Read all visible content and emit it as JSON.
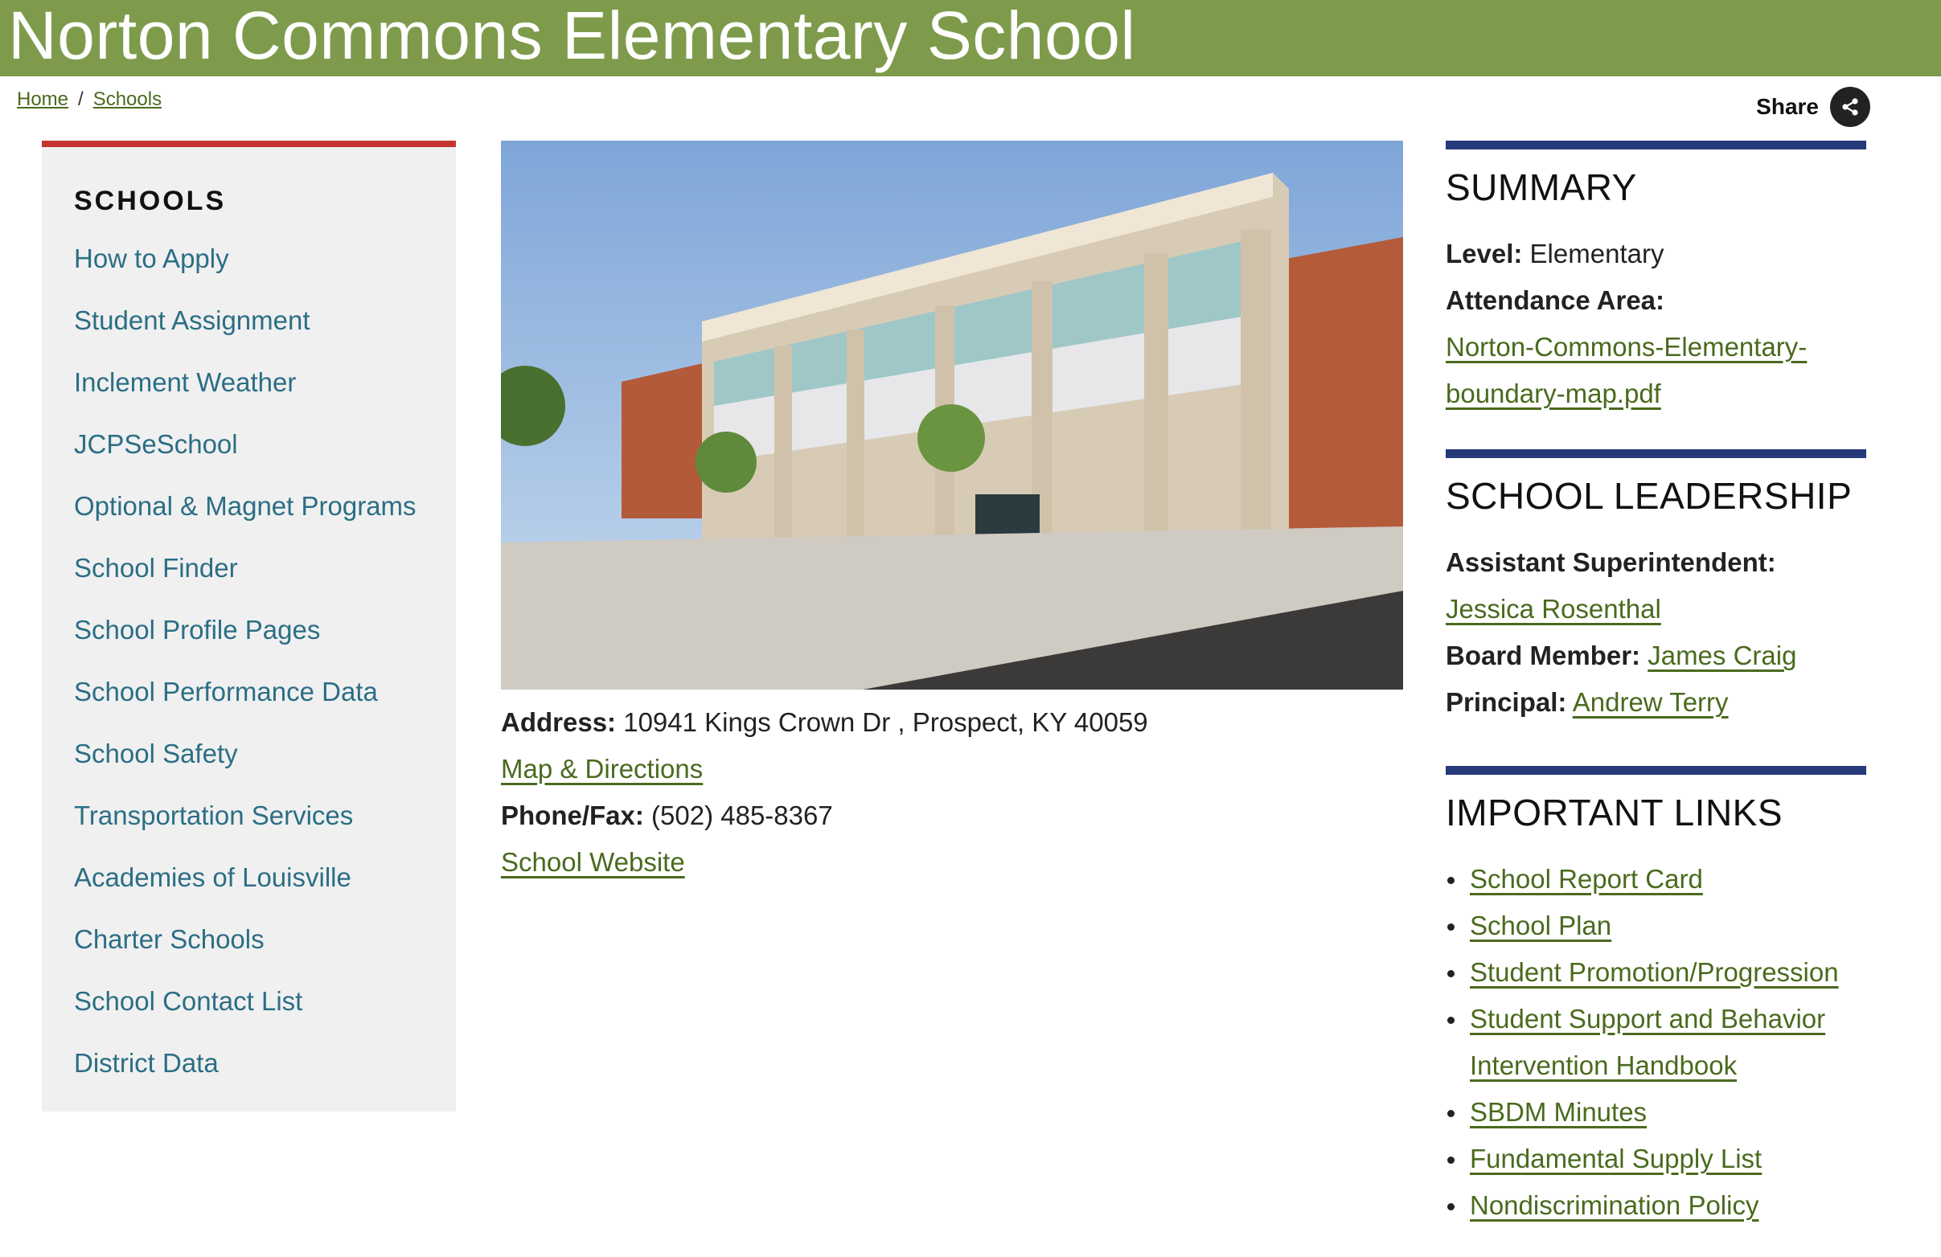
{
  "page_title": "Norton Commons Elementary School",
  "breadcrumb": {
    "home": "Home",
    "separator": "/",
    "schools": "Schools"
  },
  "share": {
    "label": "Share",
    "icon": "share-icon"
  },
  "sidebar": {
    "heading": "SCHOOLS",
    "items": [
      "How to Apply",
      "Student Assignment",
      "Inclement Weather",
      "JCPSeSchool",
      "Optional & Magnet Programs",
      "School Finder",
      "School Profile Pages",
      "School Performance Data",
      "School Safety",
      "Transportation Services",
      "Academies of Louisville",
      "Charter Schools",
      "School Contact List",
      "District Data"
    ]
  },
  "school": {
    "address_label": "Address:",
    "address": "10941 Kings Crown Dr , Prospect, KY 40059",
    "map_link": "Map & Directions",
    "phone_label": "Phone/Fax:",
    "phone": "(502) 485-8367",
    "website_link": "School Website"
  },
  "summary": {
    "heading": "SUMMARY",
    "level_label": "Level:",
    "level": "Elementary",
    "attendance_label": "Attendance Area:",
    "boundary_link_line1": "Norton-Commons-Elementary-",
    "boundary_link_line2": "boundary-map.pdf"
  },
  "leadership": {
    "heading": "SCHOOL LEADERSHIP",
    "asst_label": "Assistant Superintendent:",
    "asst_name": "Jessica Rosenthal",
    "board_label": "Board Member:",
    "board_name": "James Craig",
    "principal_label": "Principal:",
    "principal_name": "Andrew Terry"
  },
  "important_links": {
    "heading": "IMPORTANT LINKS",
    "items": [
      "School Report Card",
      "School Plan",
      "Student Promotion/Progression",
      "Student Support and Behavior",
      "SBDM Minutes",
      "Fundamental Supply List",
      "Nondiscrimination Policy"
    ],
    "item_3_line2": "Intervention Handbook"
  },
  "colors": {
    "banner": "#7e9b4b",
    "sidebar_accent": "#c3352e",
    "section_rule": "#253a7a",
    "link": "#4a6a1e",
    "sidebar_link": "#2b6e85"
  }
}
